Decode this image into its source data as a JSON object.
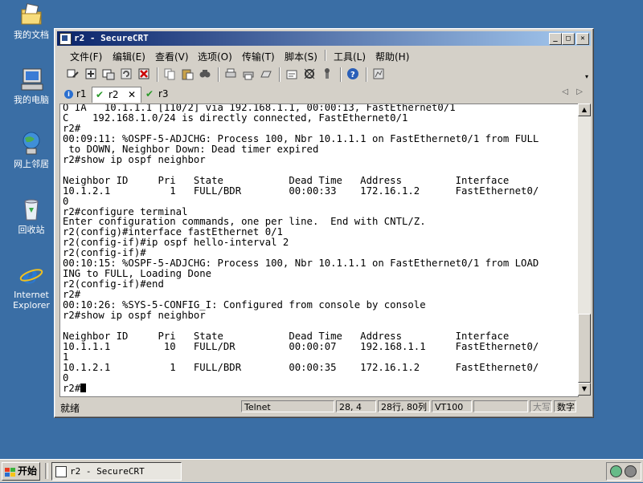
{
  "desktop": {
    "icons": [
      {
        "label": "我的文档",
        "icon": "my-documents-icon"
      },
      {
        "label": "我的电脑",
        "icon": "my-computer-icon"
      },
      {
        "label": "网上邻居",
        "icon": "network-places-icon"
      },
      {
        "label": "回收站",
        "icon": "recycle-bin-icon"
      },
      {
        "label": "Internet Explorer",
        "icon": "internet-explorer-icon"
      }
    ]
  },
  "window": {
    "title": "r2 - SecureCRT",
    "menu": [
      "文件(F)",
      "编辑(E)",
      "查看(V)",
      "选项(O)",
      "传输(T)",
      "脚本(S)",
      "工具(L)",
      "帮助(H)"
    ],
    "tabs": [
      {
        "label": "r1",
        "icon": "info-icon"
      },
      {
        "label": "r2",
        "icon": "check-icon",
        "close": "✕"
      },
      {
        "label": "r3",
        "icon": "check-icon"
      }
    ],
    "terminal_lines": [
      "O IA   10.1.1.1 [110/2] via 192.168.1.1, 00:00:13, FastEthernet0/1",
      "C    192.168.1.0/24 is directly connected, FastEthernet0/1",
      "r2#",
      "00:09:11: %OSPF-5-ADJCHG: Process 100, Nbr 10.1.1.1 on FastEthernet0/1 from FULL",
      " to DOWN, Neighbor Down: Dead timer expired",
      "r2#show ip ospf neighbor",
      "",
      "Neighbor ID     Pri   State           Dead Time   Address         Interface",
      "10.1.2.1          1   FULL/BDR        00:00:33    172.16.1.2      FastEthernet0/",
      "0",
      "r2#configure terminal",
      "Enter configuration commands, one per line.  End with CNTL/Z.",
      "r2(config)#interface fastEthernet 0/1",
      "r2(config-if)#ip ospf hello-interval 2",
      "r2(config-if)#",
      "00:10:15: %OSPF-5-ADJCHG: Process 100, Nbr 10.1.1.1 on FastEthernet0/1 from LOAD",
      "ING to FULL, Loading Done",
      "r2(config-if)#end",
      "r2#",
      "00:10:26: %SYS-5-CONFIG_I: Configured from console by console",
      "r2#show ip ospf neighbor",
      "",
      "Neighbor ID     Pri   State           Dead Time   Address         Interface",
      "10.1.1.1         10   FULL/DR         00:00:07    192.168.1.1     FastEthernet0/",
      "1",
      "10.1.2.1          1   FULL/BDR        00:00:35    172.16.1.2      FastEthernet0/",
      "0"
    ],
    "prompt": "r2#",
    "status": {
      "ready": "就绪",
      "protocol": "Telnet",
      "cursor_pos": "28,  4",
      "size": "28行, 80列",
      "terminal_type": "VT100",
      "caps": "大写",
      "num": "数字"
    }
  },
  "taskbar": {
    "start_label": "开始",
    "task_label": "r2 - SecureCRT"
  }
}
